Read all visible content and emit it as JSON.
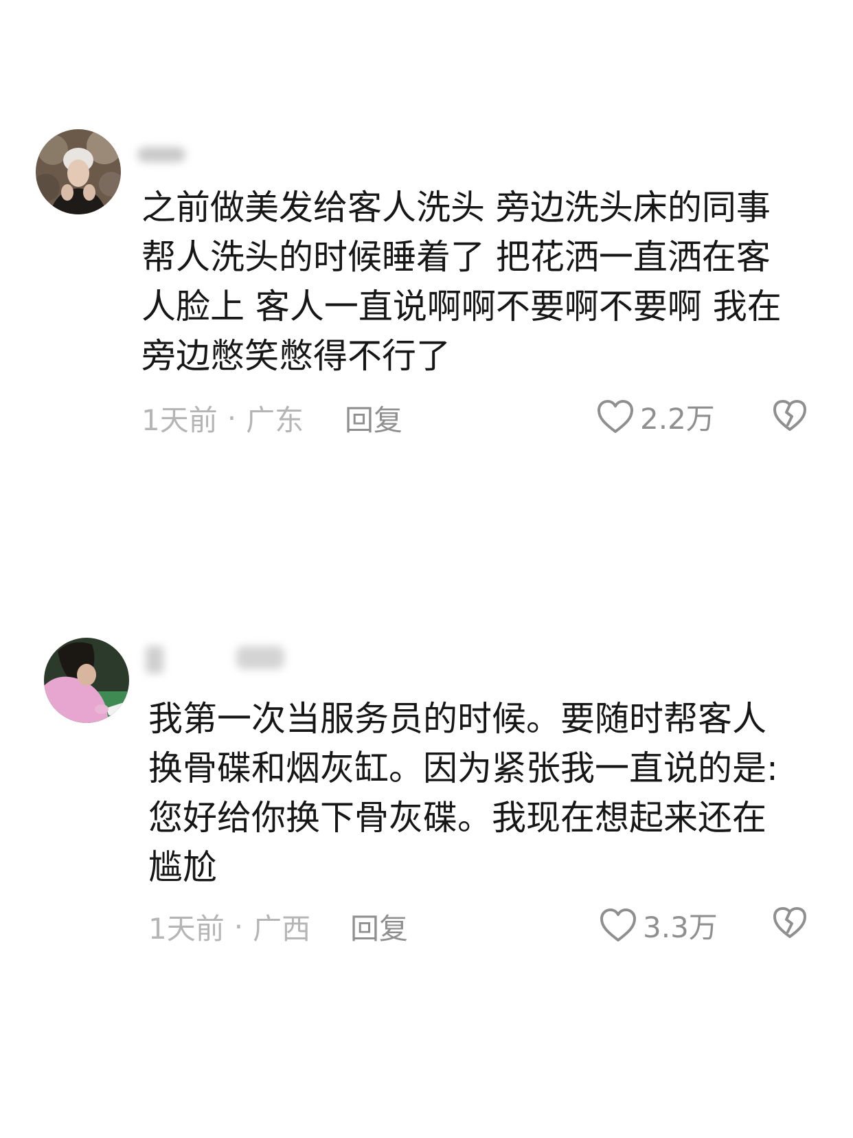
{
  "comments": [
    {
      "text": "之前做美发给客人洗头 旁边洗头床的同事\n帮人洗头的时候睡着了 把花洒一直洒在客\n人脸上 客人一直说啊啊不要啊不要啊 我在\n旁边憋笑憋得不行了",
      "time": "1天前",
      "location": "广东",
      "separator": "·",
      "reply_label": "回复",
      "like_count": "2.2万",
      "like_icon": "heart-outline-icon",
      "dislike_icon": "broken-heart-icon"
    },
    {
      "text": "我第一次当服务员的时候。要随时帮客人\n换骨碟和烟灰缸。因为紧张我一直说的是:\n您好给你换下骨灰碟。我现在想起来还在\n尴尬",
      "time": "1天前",
      "location": "广西",
      "separator": "·",
      "reply_label": "回复",
      "like_count": "3.3万",
      "like_icon": "heart-outline-icon",
      "dislike_icon": "broken-heart-icon"
    }
  ],
  "colors": {
    "text": "#161616",
    "meta": "#b5b5b5",
    "action": "#8f8f8f"
  }
}
